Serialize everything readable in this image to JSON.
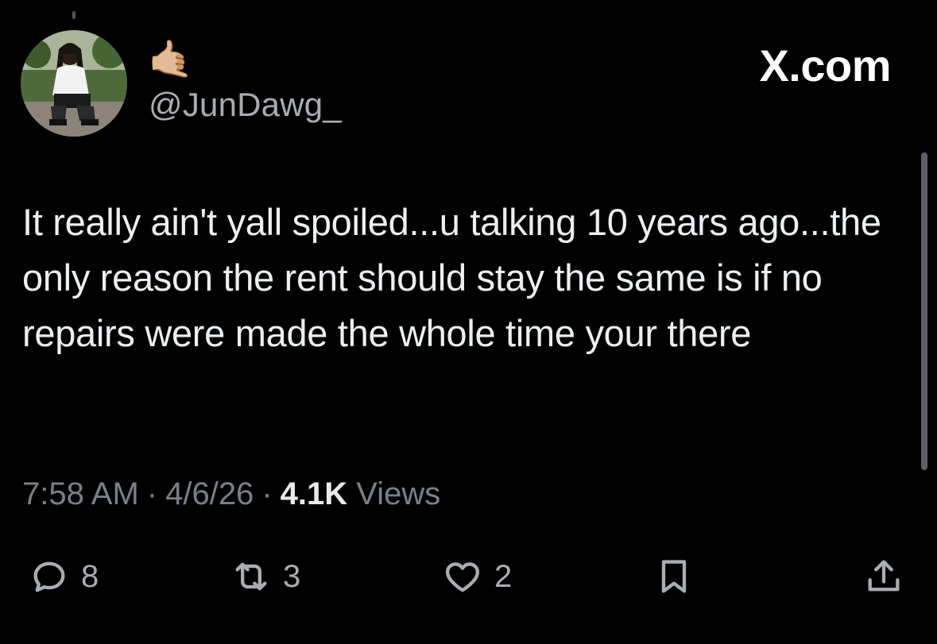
{
  "header": {
    "emoji": "🤙🏼",
    "handle": "@JunDawg_",
    "brand": "X.com"
  },
  "tweet": {
    "text": "It really ain't yall spoiled...u talking 10 years ago...the only reason the rent should stay the same is if no repairs were made the whole time your there"
  },
  "meta": {
    "time": "7:58 AM",
    "date": "4/6/26",
    "views_count": "4.1K",
    "views_label": "Views"
  },
  "actions": {
    "replies": "8",
    "reposts": "3",
    "likes": "2"
  },
  "icons": [
    "reply-icon",
    "repost-icon",
    "like-icon",
    "bookmark-icon",
    "share-icon"
  ],
  "colors": {
    "background": "#000000",
    "text": "#e7e9ea",
    "muted": "#7b8087"
  }
}
